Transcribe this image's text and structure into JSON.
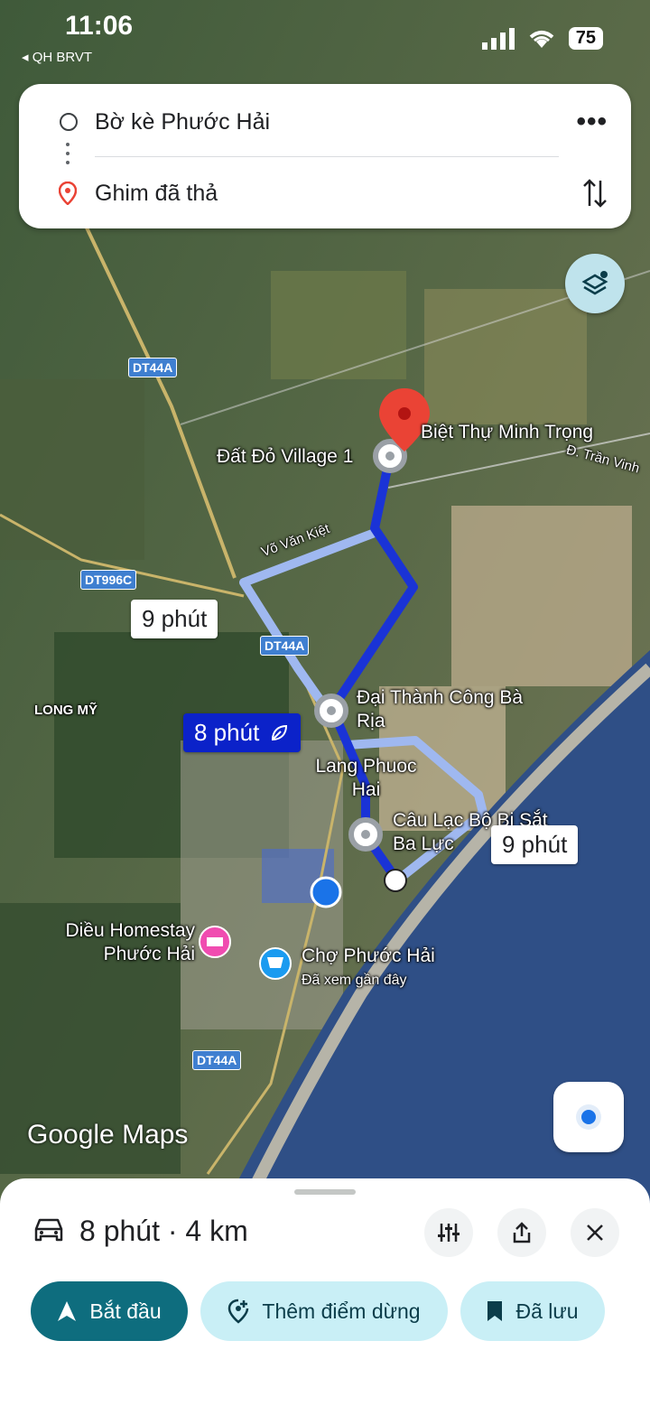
{
  "status_bar": {
    "time": "11:06",
    "carrier": "◂ QH BRVT",
    "battery": "75"
  },
  "directions": {
    "origin": "Bờ kè Phước Hải",
    "destination": "Ghim đã thả"
  },
  "map": {
    "places": [
      "Biệt Thự Minh Trọng",
      "Đất Đỏ Village 1",
      "Đại Thành Công Bà Rịa",
      "Lang Phuoc Hai",
      "Câu Lạc Bộ Bi Sắt Ba Lực",
      "Diều Homestay Phước Hải",
      "Chợ Phước Hải",
      "Đã xem gần đây",
      "LONG MỸ",
      "Đ. Trần Vinh",
      "Võ Văn Kiệt"
    ],
    "road_labels": [
      "DT44A",
      "DT996C",
      "DT44A",
      "DT44A"
    ],
    "route_times": {
      "alt1": "9 phút",
      "selected": "8 phút",
      "alt2": "9 phút"
    },
    "logo": "Google Maps"
  },
  "bottom_sheet": {
    "summary": "8 phút · 4 km",
    "start_label": "Bắt đầu",
    "add_stop_label": "Thêm điểm dừng",
    "saved_label": "Đã lưu"
  },
  "colors": {
    "route_selected": "#1a33d6",
    "route_alt": "#9fb8f0",
    "start_button": "#0e6d7e",
    "pill_bg": "#c9eff6"
  }
}
